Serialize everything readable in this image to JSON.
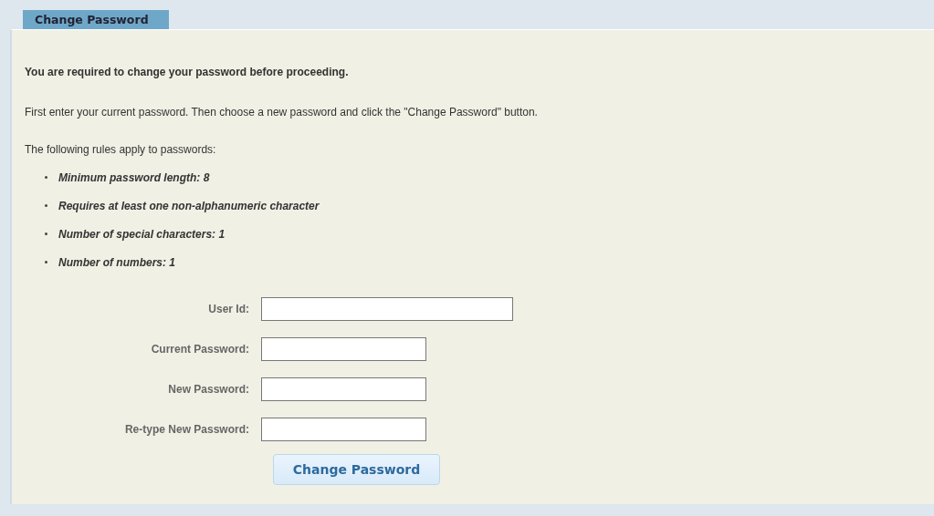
{
  "tab": {
    "label": "Change Password",
    "selected": true
  },
  "notice": "You are required to change your password before proceeding.",
  "instructions": "First enter your current password. Then choose a new password and click the \"Change Password\" button.",
  "rules_intro": "The following rules apply to passwords:",
  "rules": [
    "Minimum password length: 8",
    "Requires at least one non-alphanumeric character",
    "Number of special characters: 1",
    "Number of numbers: 1"
  ],
  "fields": [
    {
      "label": "User Id:",
      "kind": "text"
    },
    {
      "label": "Current Password:",
      "kind": "password"
    },
    {
      "label": "New Password:",
      "kind": "password"
    },
    {
      "label": "Re-type New Password:",
      "kind": "password"
    }
  ],
  "submit": "Change Password"
}
